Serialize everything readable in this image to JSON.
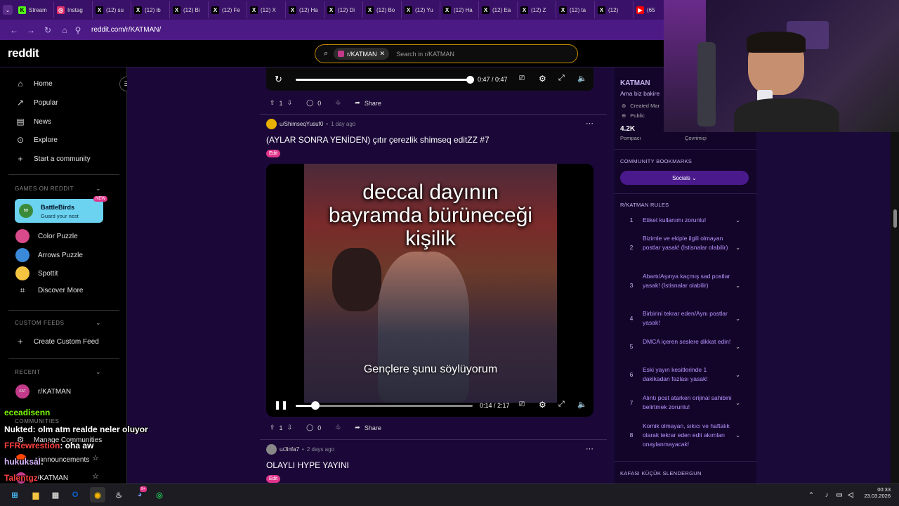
{
  "browser": {
    "tabs": [
      {
        "label": "Stream",
        "icon": "kick-icon",
        "color": "#53fc18",
        "glyph": "K"
      },
      {
        "label": "Instag",
        "icon": "instagram-icon",
        "color": "#e1306c",
        "glyph": "◎"
      },
      {
        "label": "(12) su",
        "icon": "x-icon",
        "color": "#000000",
        "glyph": "X"
      },
      {
        "label": "(12) ib",
        "icon": "x-icon",
        "color": "#000000",
        "glyph": "X"
      },
      {
        "label": "(12) Bi",
        "icon": "x-icon",
        "color": "#000000",
        "glyph": "X"
      },
      {
        "label": "(12) Fe",
        "icon": "x-icon",
        "color": "#000000",
        "glyph": "X"
      },
      {
        "label": "(12) X",
        "icon": "x-icon",
        "color": "#000000",
        "glyph": "X"
      },
      {
        "label": "(12) Ha",
        "icon": "x-icon",
        "color": "#000000",
        "glyph": "X"
      },
      {
        "label": "(12) Di",
        "icon": "x-icon",
        "color": "#000000",
        "glyph": "X"
      },
      {
        "label": "(12) Bo",
        "icon": "x-icon",
        "color": "#000000",
        "glyph": "X"
      },
      {
        "label": "(12) Yu",
        "icon": "x-icon",
        "color": "#000000",
        "glyph": "X"
      },
      {
        "label": "(12) Ha",
        "icon": "x-icon",
        "color": "#000000",
        "glyph": "X"
      },
      {
        "label": "(12) Ea",
        "icon": "x-icon",
        "color": "#000000",
        "glyph": "X"
      },
      {
        "label": "(12) Z",
        "icon": "x-icon",
        "color": "#000000",
        "glyph": "X"
      },
      {
        "label": "(12) ta",
        "icon": "x-icon",
        "color": "#000000",
        "glyph": "X"
      },
      {
        "label": "(12)",
        "icon": "x-icon",
        "color": "#000000",
        "glyph": "X"
      },
      {
        "label": "(65",
        "icon": "youtube-icon",
        "color": "#ff0000",
        "glyph": "▶"
      }
    ],
    "url": "reddit.com/r/KATMAN/"
  },
  "header": {
    "logo": "reddit",
    "search_chip": "r/KATMAN",
    "search_placeholder": "Search in r/KATMAN"
  },
  "sidebar": {
    "nav": [
      {
        "label": "Home",
        "icon": "home-icon",
        "glyph": "⌂"
      },
      {
        "label": "Popular",
        "icon": "popular-icon",
        "glyph": "↗"
      },
      {
        "label": "News",
        "icon": "news-icon",
        "glyph": "▤"
      },
      {
        "label": "Explore",
        "icon": "explore-icon",
        "glyph": "⊙"
      },
      {
        "label": "Start a community",
        "icon": "plus-icon",
        "glyph": "+"
      }
    ],
    "games_heading": "GAMES ON REDDIT",
    "battlebirds": {
      "title": "BattleBirds",
      "subtitle": "Guard your nest",
      "badge": "NEW"
    },
    "games": [
      {
        "label": "Color Puzzle",
        "icon": "color-puzzle-icon"
      },
      {
        "label": "Arrows Puzzle",
        "icon": "arrows-puzzle-icon"
      },
      {
        "label": "Spottit",
        "icon": "spottit-icon"
      },
      {
        "label": "Discover More",
        "icon": "gamepad-icon"
      }
    ],
    "custom_feeds_heading": "CUSTOM FEEDS",
    "create_custom_feed": "Create Custom Feed",
    "recent_heading": "RECENT",
    "recent_item": "r/KATMAN",
    "communities_heading": "COMMUNITIES",
    "manage_communities": "Manage Communities",
    "announcements": "r/announcements",
    "katman_community": "r/KATMAN"
  },
  "feed": {
    "top_player": {
      "time": "0:47 / 0:47"
    },
    "post1": {
      "upvotes": "1",
      "comments": "0",
      "share": "Share"
    },
    "post2": {
      "author": "u/ShimseqYusuf0",
      "age": "1 day ago",
      "title": "(AYLAR SONRA YENİDEN) çıtır çerezlik shimseq editZZ #7",
      "flair": "Edit",
      "caption_line1": "deccal dayının",
      "caption_line2": "bayramda bürüneceği",
      "caption_line3": "kişilik",
      "subtitle": "Gençlere şunu söylüyorum",
      "time": "0:14 / 2:17",
      "progress": 0.11,
      "upvotes": "1",
      "comments": "0",
      "share": "Share"
    },
    "post3": {
      "author": "u/Jinfa7",
      "age": "2 days ago",
      "title": "OLAYLI HYPE YAYINI",
      "flair": "Edit"
    }
  },
  "right": {
    "name": "KATMAN",
    "tagline": "Ama biz bakire",
    "created": "Created Mar",
    "visibility": "Public",
    "members_count": "4.2K",
    "members_label": "Pompacı",
    "online_label": "Çevrimiçi",
    "bookmarks_heading": "COMMUNITY BOOKMARKS",
    "socials": "Socials",
    "rules_heading": "R/KATMAN RULES",
    "rules": [
      {
        "n": "1",
        "text": "Etiket kullanımı zorunlu!"
      },
      {
        "n": "2",
        "text": "Bizimle ve ekiple ilgili olmayan postlar yasak! (İstisnalar olabilir)"
      },
      {
        "n": "3",
        "text": "Abartı/Aşınya kaçmış sad postlar yasak! (İstisnalar olabilir)"
      },
      {
        "n": "4",
        "text": "Birbirini tekrar eden/Aynı postlar yasak!"
      },
      {
        "n": "5",
        "text": "DMCA içeren seslere dikkat edin!"
      },
      {
        "n": "6",
        "text": "Eski yayın kesitlerinde 1 dakikadan fazlası yasak!"
      },
      {
        "n": "7",
        "text": "Alıntı post atarken orijinal sahibini belirtmek zorunlu!"
      },
      {
        "n": "8",
        "text": "Komik olmayan, sıkıcı ve haftalık olarak tekrar eden edit akımları onaylanmayacak!"
      }
    ],
    "next_heading": "KAFASI KÜÇÜK SLENDERGUN"
  },
  "chat": [
    {
      "user": "eceadisenn",
      "msg": "",
      "color": "#7cfc00"
    },
    {
      "user": "Nukted",
      "msg": ": olm atm realde neler oluyor",
      "color": "#ffffff"
    },
    {
      "user": "FFRewrestion",
      "msg": ": oha aw",
      "color": "#ff4040"
    },
    {
      "user": "hukuksal",
      "msg": ":",
      "color": "#d7b8ff"
    },
    {
      "user": "Talentgz",
      "msg": "",
      "color": "#ff4040"
    }
  ],
  "taskbar": {
    "time": "00:33",
    "date": "23.03.2026",
    "steam_badge": "9+"
  },
  "colors": {
    "accent": "#e0358a",
    "browser_purple": "#4c1a85",
    "feed_bg": "#1b0838"
  }
}
